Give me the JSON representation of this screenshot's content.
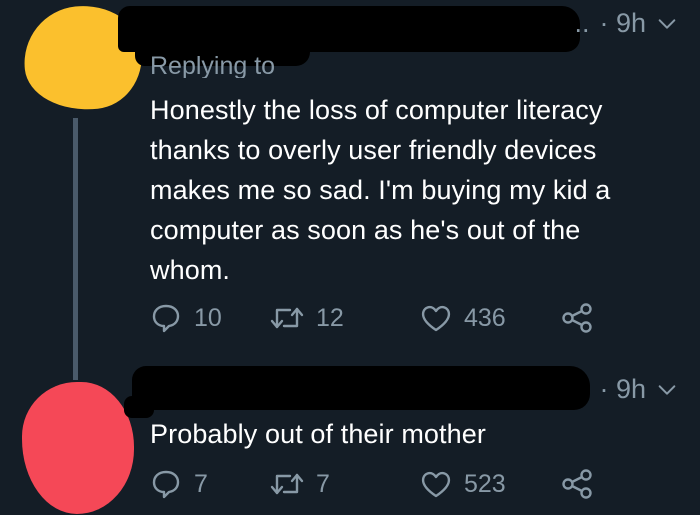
{
  "colors": {
    "background": "#141d26",
    "text": "#ffffff",
    "muted": "#8899a6",
    "avatar_1": "#fbc02d",
    "avatar_2": "#f54857"
  },
  "tweets": [
    {
      "time": "· 9h",
      "ellipsis": "..",
      "replying": "Replying to",
      "text": "Honestly the loss of computer literacy\nthanks to overly user friendly devices\nmakes me so sad. I'm buying my kid a\ncomputer as soon as he's out of the\nwhom.",
      "replies": "10",
      "retweets": "12",
      "likes": "436"
    },
    {
      "time": "· 9h",
      "text": "Probably out of their mother",
      "replies": "7",
      "retweets": "7",
      "likes": "523"
    }
  ],
  "icons": [
    "reply-icon",
    "retweet-icon",
    "like-icon",
    "share-icon",
    "chevron-down-icon"
  ]
}
